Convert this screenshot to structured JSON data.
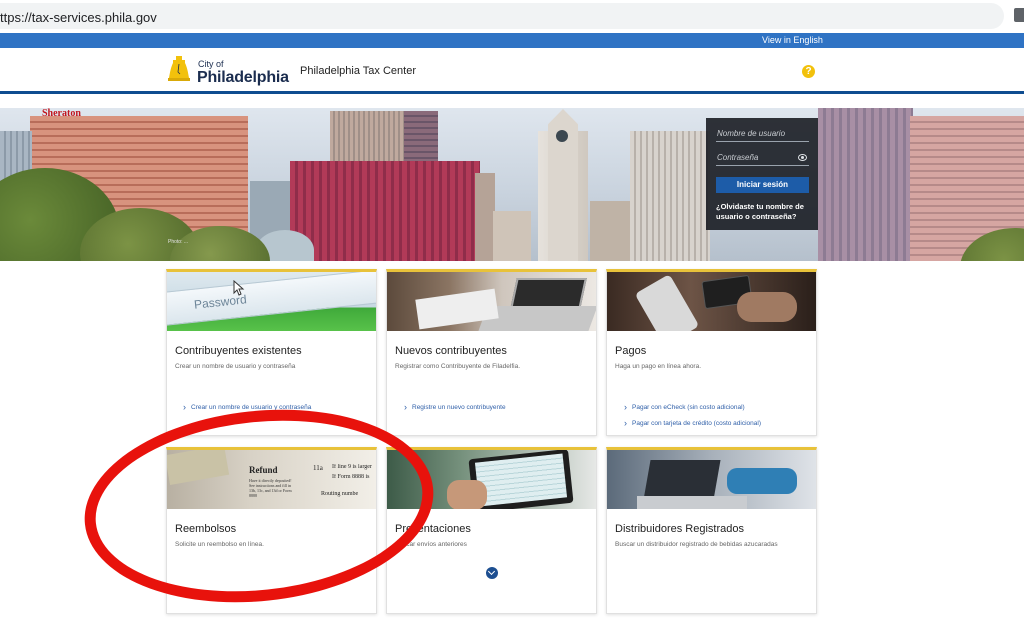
{
  "browser": {
    "url": "ttps://tax-services.phila.gov"
  },
  "top_strip": {
    "language_link": "View in English"
  },
  "header": {
    "logo_city": "City of",
    "logo_name": "Philadelphia",
    "site_title": "Philadelphia Tax Center",
    "help_symbol": "?"
  },
  "hero": {
    "photo_credit": "Photo: ..."
  },
  "login": {
    "username_placeholder": "Nombre de usuario",
    "password_placeholder": "Contraseña",
    "submit_label": "Iniciar sesión",
    "forgot_text": "¿Olvidaste tu nombre de usuario o contraseña?"
  },
  "cards": [
    {
      "title": "Contribuyentes existentes",
      "description": "Crear un nombre de usuario y contraseña",
      "links": [
        "Crear un nombre de usuario y contraseña"
      ]
    },
    {
      "title": "Nuevos contribuyentes",
      "description": "Registrar como Contribuyente de Filadelfia.",
      "links": [
        "Registre un nuevo contribuyente"
      ]
    },
    {
      "title": "Pagos",
      "description": "Haga un pago en línea ahora.",
      "links": [
        "Pagar con eCheck (sin costo adicional)",
        "Pagar con tarjeta de crédito (costo adicional)"
      ]
    },
    {
      "title": "Reembolsos",
      "description": "Solicite un reembolso en línea.",
      "image_text": {
        "heading": "Refund",
        "line_no": "11a",
        "line1": "If line 9 is larger",
        "line2": "If Form 8888 is",
        "routing": "Routing numbe",
        "note": "Have it directly deposited! See instructions and fill in 13b, 13c, and 13d or Form 8888"
      },
      "links": []
    },
    {
      "title": "Presentaciones",
      "description": "Buscar envíos anteriores",
      "links": []
    },
    {
      "title": "Distribuidores Registrados",
      "description": "Buscar un distribuidor registrado de bebidas azucaradas",
      "links": []
    }
  ],
  "card1_image_text": "Password",
  "hero_sign": "Sheraton",
  "colors": {
    "accent_blue": "#2f73c4",
    "header_rule": "#0f4d90",
    "card_border": "#e8c23a",
    "highlight": "#e8120c"
  }
}
